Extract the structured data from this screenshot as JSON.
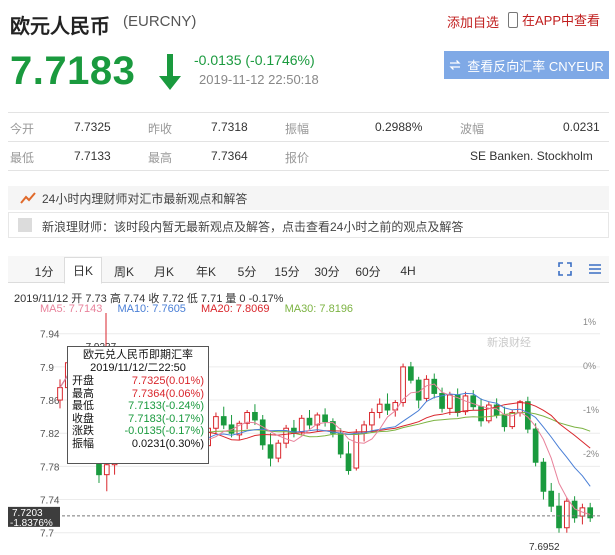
{
  "header": {
    "title": "欧元人民币",
    "code": "(EURCNY)",
    "add_favorite": "添加自选",
    "app_link": "在APP中查看",
    "price": "7.7183",
    "change": "-0.0135 (-0.1746%)",
    "datetime": "2019-11-12 22:50:18",
    "reverse_button": "查看反向汇率 CNYEUR",
    "down_color": "#1a9a3e",
    "up_color": "#d9262c"
  },
  "stats": {
    "row1": [
      {
        "label": "今开",
        "value": "7.7325"
      },
      {
        "label": "昨收",
        "value": "7.7318"
      },
      {
        "label": "振幅",
        "value": "0.2988%"
      },
      {
        "label": "波幅",
        "value": "0.0231"
      }
    ],
    "row2": [
      {
        "label": "最低",
        "value": "7.7133"
      },
      {
        "label": "最高",
        "value": "7.7364"
      },
      {
        "label": "报价",
        "value": "SE Banken. Stockholm"
      }
    ]
  },
  "opinion": {
    "title": "24小时内理财师对汇市最新观点和解答",
    "message": "新浪理财师：该时段内暂无最新观点及解答，点击查看24小时之前的观点及解答"
  },
  "tabs": [
    "1分",
    "日K",
    "周K",
    "月K",
    "年K",
    "5分",
    "15分",
    "30分",
    "60分",
    "4H"
  ],
  "active_tab": "日K",
  "chart_header": {
    "ohlc": "2019/11/12 开 7.73 高 7.74 收 7.72 低 7.71 量 0 -0.17%",
    "ma5": "MA5: 7.7143",
    "ma10": "MA10: 7.7605",
    "ma20": "MA20: 7.8069",
    "ma30": "MA30: 7.8196",
    "ma5_color": "#e8829b",
    "ma10_color": "#4a7fd6",
    "ma20_color": "#d9262c",
    "ma30_color": "#7cb342"
  },
  "tooltip": {
    "title": "欧元兑人民币即期汇率",
    "date": "2019/11/12/二22:50",
    "rows": [
      {
        "k": "开盘",
        "v": "7.7325(0.01%)"
      },
      {
        "k": "最高",
        "v": "7.7364(0.06%)"
      },
      {
        "k": "最低",
        "v": "7.7133(-0.24%)"
      },
      {
        "k": "收盘",
        "v": "7.7183(-0.17%)"
      },
      {
        "k": "涨跌",
        "v": "-0.0135(-0.17%)"
      },
      {
        "k": "振幅",
        "v": "0.0231(0.30%)"
      }
    ]
  },
  "chart_data": {
    "type": "candlestick",
    "y_ticks": [
      "7.94",
      "7.9",
      "7.86",
      "7.82",
      "7.78",
      "7.74",
      "7.7"
    ],
    "right_ticks": [
      "1%",
      "0%",
      "-1%",
      "-2%"
    ],
    "y_range": [
      7.69,
      7.965
    ],
    "annotations": {
      "max": "7.9237",
      "min": "7.6952"
    },
    "current_price_label": "7.7203",
    "current_pct_label": "-1.8376%",
    "watermark": "新浪财经",
    "candles": [
      [
        7.86,
        7.885,
        7.85,
        7.875
      ],
      [
        7.875,
        7.92,
        7.868,
        7.905
      ],
      [
        7.905,
        7.924,
        7.885,
        7.892
      ],
      [
        7.89,
        7.895,
        7.83,
        7.84
      ],
      [
        7.842,
        7.848,
        7.79,
        7.8
      ],
      [
        7.8,
        7.815,
        7.76,
        7.77
      ],
      [
        7.77,
        7.79,
        7.75,
        7.782
      ],
      [
        7.782,
        7.8,
        7.77,
        7.795
      ],
      [
        7.795,
        7.83,
        7.785,
        7.818
      ],
      [
        7.818,
        7.835,
        7.8,
        7.805
      ],
      [
        7.805,
        7.812,
        7.79,
        7.8
      ],
      [
        7.802,
        7.828,
        7.796,
        7.822
      ],
      [
        7.822,
        7.84,
        7.815,
        7.835
      ],
      [
        7.835,
        7.845,
        7.8,
        7.81
      ],
      [
        7.81,
        7.822,
        7.795,
        7.815
      ],
      [
        7.815,
        7.83,
        7.805,
        7.822
      ],
      [
        7.822,
        7.83,
        7.79,
        7.798
      ],
      [
        7.798,
        7.815,
        7.792,
        7.81
      ],
      [
        7.81,
        7.825,
        7.8,
        7.805
      ],
      [
        7.805,
        7.83,
        7.8,
        7.826
      ],
      [
        7.826,
        7.845,
        7.82,
        7.84
      ],
      [
        7.84,
        7.852,
        7.825,
        7.83
      ],
      [
        7.83,
        7.842,
        7.815,
        7.82
      ],
      [
        7.818,
        7.835,
        7.812,
        7.832
      ],
      [
        7.832,
        7.848,
        7.825,
        7.845
      ],
      [
        7.845,
        7.855,
        7.83,
        7.836
      ],
      [
        7.836,
        7.842,
        7.8,
        7.806
      ],
      [
        7.806,
        7.82,
        7.78,
        7.79
      ],
      [
        7.79,
        7.812,
        7.785,
        7.808
      ],
      [
        7.808,
        7.83,
        7.802,
        7.826
      ],
      [
        7.826,
        7.836,
        7.815,
        7.82
      ],
      [
        7.822,
        7.842,
        7.818,
        7.838
      ],
      [
        7.838,
        7.848,
        7.825,
        7.83
      ],
      [
        7.83,
        7.845,
        7.822,
        7.842
      ],
      [
        7.842,
        7.85,
        7.828,
        7.834
      ],
      [
        7.834,
        7.838,
        7.815,
        7.82
      ],
      [
        7.82,
        7.826,
        7.79,
        7.795
      ],
      [
        7.795,
        7.81,
        7.77,
        7.775
      ],
      [
        7.778,
        7.825,
        7.775,
        7.82
      ],
      [
        7.82,
        7.835,
        7.81,
        7.83
      ],
      [
        7.83,
        7.85,
        7.822,
        7.845
      ],
      [
        7.845,
        7.862,
        7.838,
        7.855
      ],
      [
        7.855,
        7.868,
        7.842,
        7.848
      ],
      [
        7.848,
        7.86,
        7.84,
        7.857
      ],
      [
        7.857,
        7.904,
        7.852,
        7.9
      ],
      [
        7.9,
        7.906,
        7.88,
        7.884
      ],
      [
        7.884,
        7.888,
        7.85,
        7.86
      ],
      [
        7.862,
        7.89,
        7.858,
        7.885
      ],
      [
        7.885,
        7.892,
        7.862,
        7.868
      ],
      [
        7.868,
        7.875,
        7.845,
        7.85
      ],
      [
        7.85,
        7.87,
        7.842,
        7.866
      ],
      [
        7.866,
        7.874,
        7.84,
        7.845
      ],
      [
        7.846,
        7.87,
        7.842,
        7.865
      ],
      [
        7.865,
        7.872,
        7.848,
        7.852
      ],
      [
        7.852,
        7.862,
        7.828,
        7.835
      ],
      [
        7.835,
        7.858,
        7.832,
        7.854
      ],
      [
        7.854,
        7.862,
        7.838,
        7.842
      ],
      [
        7.842,
        7.852,
        7.822,
        7.828
      ],
      [
        7.828,
        7.848,
        7.825,
        7.845
      ],
      [
        7.845,
        7.86,
        7.84,
        7.858
      ],
      [
        7.858,
        7.864,
        7.82,
        7.825
      ],
      [
        7.825,
        7.832,
        7.78,
        7.785
      ],
      [
        7.785,
        7.79,
        7.74,
        7.75
      ],
      [
        7.75,
        7.76,
        7.725,
        7.732
      ],
      [
        7.732,
        7.748,
        7.7,
        7.706
      ],
      [
        7.706,
        7.742,
        7.7,
        7.738
      ],
      [
        7.738,
        7.744,
        7.712,
        7.718
      ],
      [
        7.72,
        7.735,
        7.71,
        7.73
      ],
      [
        7.73,
        7.736,
        7.713,
        7.718
      ]
    ]
  }
}
